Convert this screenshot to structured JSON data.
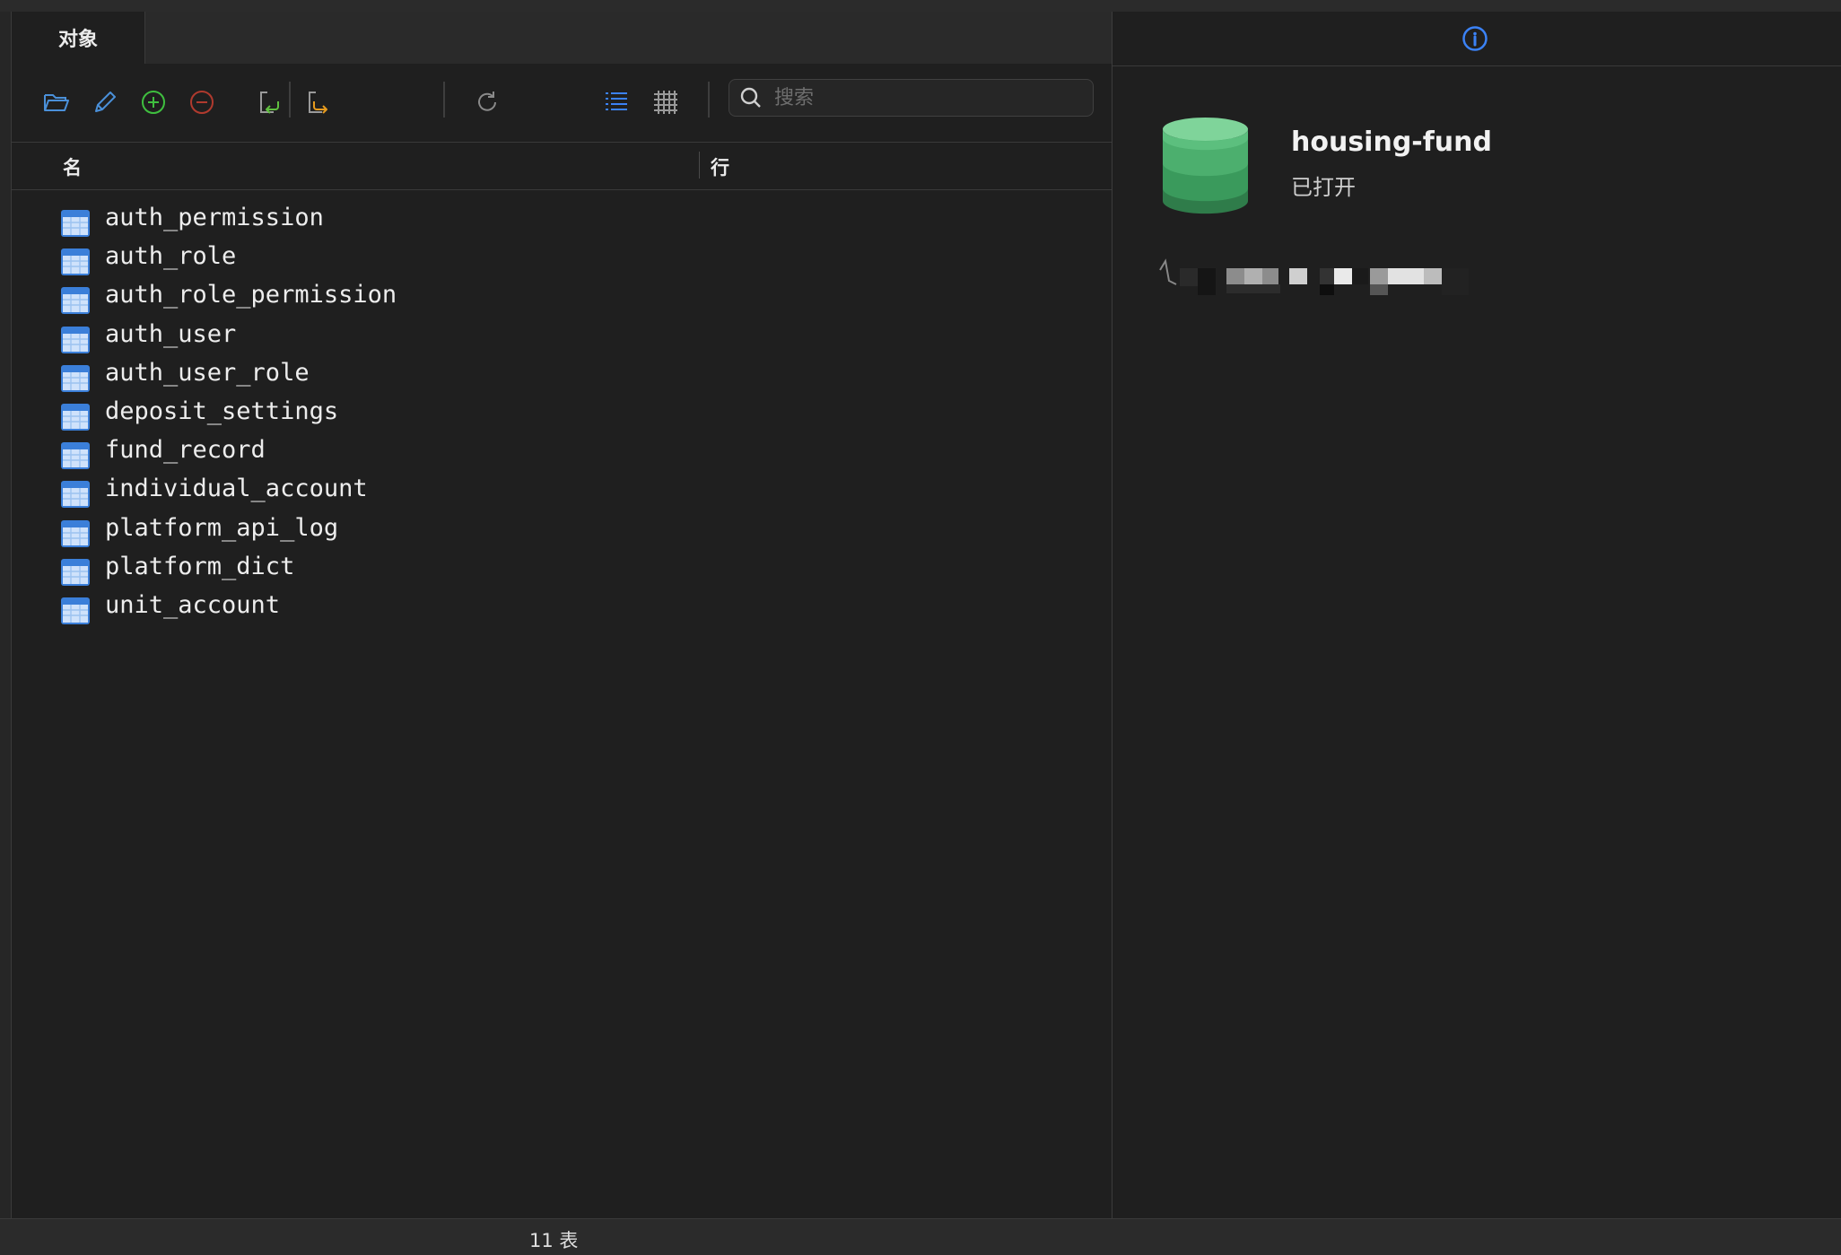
{
  "tabs": [
    {
      "label": "对象"
    }
  ],
  "toolbar": {
    "buttons": [
      {
        "name": "open-table",
        "icon": "folder-icon",
        "color": "#4a90d9"
      },
      {
        "name": "design-table",
        "icon": "pencil-icon",
        "color": "#4a90d9"
      },
      {
        "name": "new-table",
        "icon": "plus-circle-icon",
        "color": "#3fbf3f"
      },
      {
        "name": "delete-table",
        "icon": "minus-circle-icon",
        "color": "#c0392b"
      },
      {
        "name": "import",
        "icon": "import-icon",
        "color": "#5fbf3f"
      },
      {
        "name": "export",
        "icon": "export-icon",
        "color": "#e69b1e"
      },
      {
        "name": "refresh",
        "icon": "refresh-icon",
        "color": "#8a8a8a"
      },
      {
        "name": "list-view",
        "icon": "list-view-icon",
        "color": "#3b82f6"
      },
      {
        "name": "grid-view",
        "icon": "grid-view-icon",
        "color": "#9a9a9a"
      }
    ],
    "search_placeholder": "搜索"
  },
  "columns": {
    "name": "名",
    "rows": "行"
  },
  "tables": [
    {
      "name": "auth_permission"
    },
    {
      "name": "auth_role"
    },
    {
      "name": "auth_role_permission"
    },
    {
      "name": "auth_user"
    },
    {
      "name": "auth_user_role"
    },
    {
      "name": "deposit_settings"
    },
    {
      "name": "fund_record"
    },
    {
      "name": "individual_account"
    },
    {
      "name": "platform_api_log"
    },
    {
      "name": "platform_dict"
    },
    {
      "name": "unit_account"
    }
  ],
  "details": {
    "database_name": "housing-fund",
    "status": "已打开",
    "icon": "database-icon",
    "db_color": "#4caf6e"
  },
  "statusbar": {
    "text": "11 表"
  }
}
